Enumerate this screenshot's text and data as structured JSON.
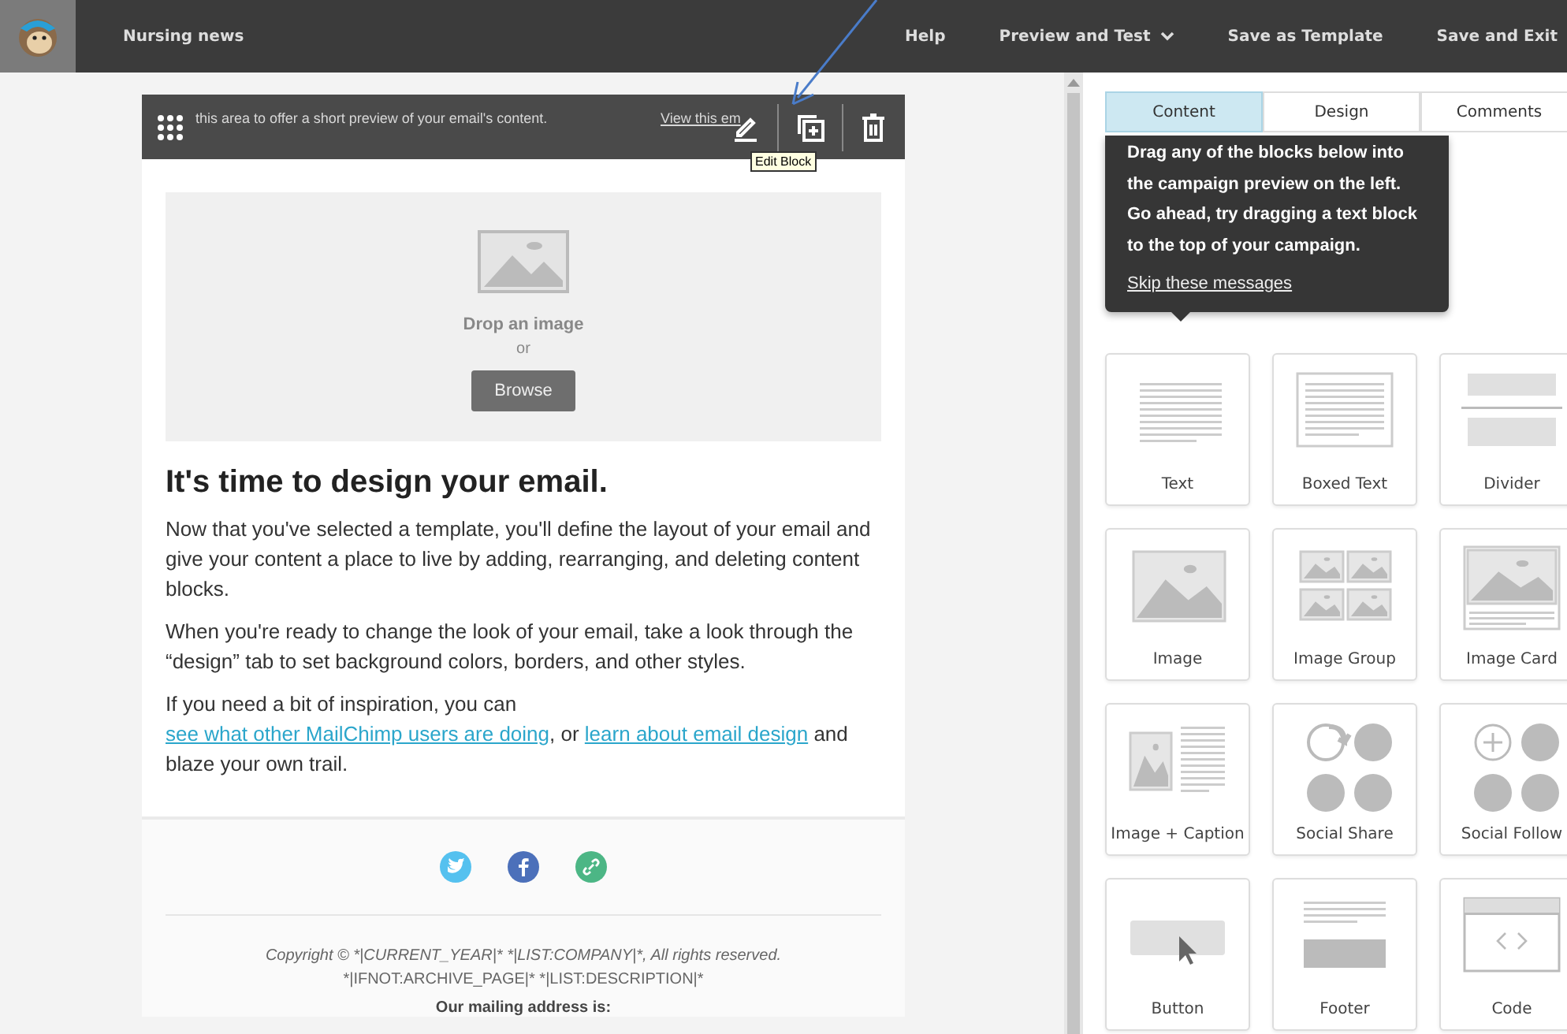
{
  "app_bar": {
    "campaign_name": "Nursing news",
    "menu": [
      {
        "label": "Help",
        "dropdown": false
      },
      {
        "label": "Preview and Test",
        "dropdown": true
      },
      {
        "label": "Save as Template",
        "dropdown": false
      },
      {
        "label": "Save and Exit",
        "dropdown": false
      }
    ]
  },
  "email": {
    "preheader": {
      "text": "this area to offer a short preview of your email's content.",
      "link": "View this em"
    },
    "block_toolbar": {
      "tooltip": "Edit Block"
    },
    "image_block": {
      "prompt": "Drop an image",
      "separator": "or",
      "button": "Browse"
    },
    "heading": "It's time to design your email.",
    "paragraphs": [
      [
        {
          "kind": "text",
          "text": "Now that you've selected a template, you'll define the layout of your email and give your content a place to live by adding, rearranging, and deleting content blocks."
        }
      ],
      [
        {
          "kind": "text",
          "text": "When you're ready to change the look of your email, take a look through the “design” tab to set background colors, borders, and other styles."
        }
      ],
      [
        {
          "kind": "text",
          "text": "If you need a bit of inspiration, you can "
        },
        {
          "kind": "link",
          "text": "see what other MailChimp users are doing"
        },
        {
          "kind": "text",
          "text": ", or "
        },
        {
          "kind": "link",
          "text": "learn about email design"
        },
        {
          "kind": "text",
          "text": " and blaze your own trail."
        }
      ]
    ],
    "social": [
      {
        "kind": "twitter",
        "color": "#55c1ef"
      },
      {
        "kind": "facebook",
        "color": "#4c70ba"
      },
      {
        "kind": "link",
        "color": "#4cb685"
      }
    ],
    "footer_lines": [
      "Copyright © *|CURRENT_YEAR|* *|LIST:COMPANY|*, All rights reserved.",
      "*|IFNOT:ARCHIVE_PAGE|* *|LIST:DESCRIPTION|*"
    ],
    "mailing_label": "Our mailing address is:"
  },
  "panel": {
    "tabs": [
      {
        "label": "Content",
        "selected": true
      },
      {
        "label": "Design",
        "selected": false
      },
      {
        "label": "Comments",
        "selected": false
      }
    ],
    "tip": {
      "text": "Drag any of the blocks below into the campaign preview on the left. Go ahead, try dragging a text block to the top of your campaign.",
      "link": "Skip these messages"
    },
    "blocks": [
      {
        "kind": "text",
        "label": "Text"
      },
      {
        "kind": "boxed",
        "label": "Boxed Text"
      },
      {
        "kind": "divider",
        "label": "Divider"
      },
      {
        "kind": "image",
        "label": "Image"
      },
      {
        "kind": "group",
        "label": "Image Group"
      },
      {
        "kind": "card",
        "label": "Image Card"
      },
      {
        "kind": "caption",
        "label": "Image + Caption"
      },
      {
        "kind": "share",
        "label": "Social Share"
      },
      {
        "kind": "follow",
        "label": "Social Follow"
      },
      {
        "kind": "button",
        "label": "Button"
      },
      {
        "kind": "footer",
        "label": "Footer"
      },
      {
        "kind": "code",
        "label": "Code"
      }
    ]
  }
}
